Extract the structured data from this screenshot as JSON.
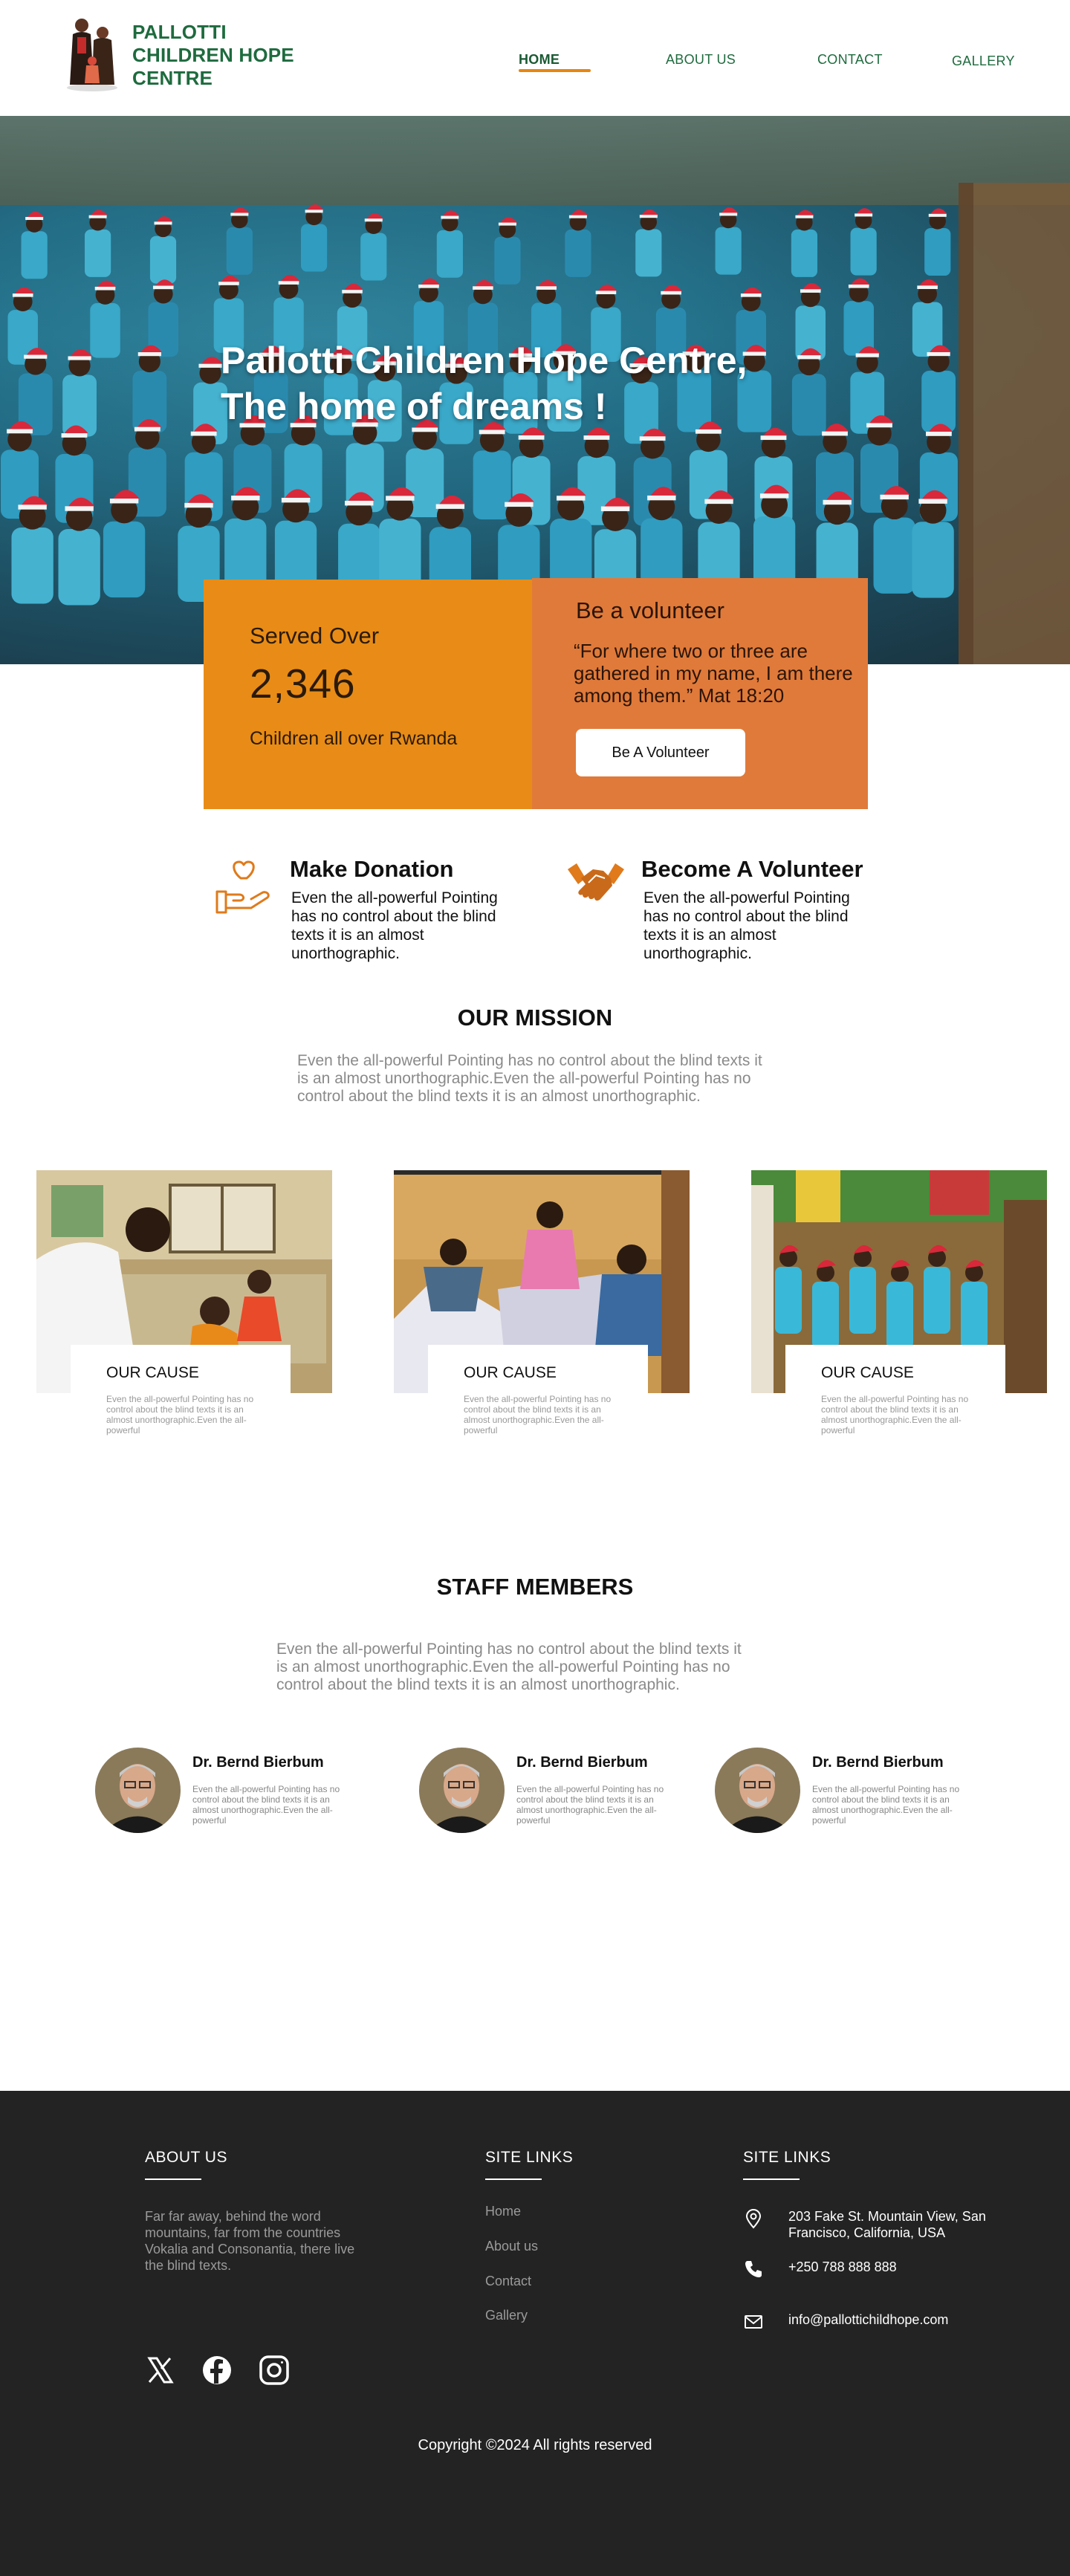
{
  "header": {
    "brand_line1": "PALLOTTI",
    "brand_line2": "CHILDREN HOPE",
    "brand_line3": "CENTRE",
    "nav": {
      "home": "HOME",
      "about": "ABOUT US",
      "contact": "CONTACT",
      "gallery": "GALLERY"
    },
    "active_nav": "HOME",
    "brand_color": "#1e6b3e",
    "accent_color": "#e8850f"
  },
  "hero": {
    "title_line1": "Pallotti Children Hope Centre,",
    "title_line2": "The home of dreams !"
  },
  "stats": {
    "served_label": "Served Over",
    "served_number": "2,346",
    "served_sub": "Children all over  Rwanda",
    "served_color": "#e88c17"
  },
  "volunteer_box": {
    "title": "Be a volunteer",
    "quote": "“For where two or three are gathered in my name, I am there among them.”  Mat 18:20",
    "button": "Be A Volunteer",
    "box_color": "#e07a3a"
  },
  "features": {
    "donate": {
      "icon": "heart-hand-icon",
      "title": "Make Donation",
      "text": "Even the all-powerful Pointing has no control about the blind texts it is an almost unorthographic."
    },
    "volunteer": {
      "icon": "handshake-icon",
      "title": "Become A Volunteer",
      "text": "Even the all-powerful Pointing has no control about the blind texts it is an almost unorthographic."
    }
  },
  "mission": {
    "title": "OUR MISSION",
    "text": "Even the all-powerful Pointing has no control about the blind texts it is an almost unorthographic.Even the all-powerful Pointing has no control about the blind texts it is an almost unorthographic."
  },
  "causes": [
    {
      "title": "OUR CAUSE",
      "text": "Even the all-powerful Pointing has no control about the blind texts it is an almost unorthographic.Even the all-powerful"
    },
    {
      "title": "OUR CAUSE",
      "text": "Even the all-powerful Pointing has no control about the blind texts it is an almost unorthographic.Even the all-powerful"
    },
    {
      "title": "OUR CAUSE",
      "text": "Even the all-powerful Pointing has no control about the blind texts it is an almost unorthographic.Even the all-powerful"
    }
  ],
  "staff": {
    "title": "STAFF MEMBERS",
    "text": "Even the all-powerful Pointing has no control about the blind texts it is an almost unorthographic.Even the all-powerful Pointing has no control about the blind texts it is an almost unorthographic.",
    "members": [
      {
        "name": "Dr.  Bernd Bierbum",
        "text": "Even the all-powerful Pointing has no control about the blind texts it is an almost unorthographic.Even the all-powerful"
      },
      {
        "name": "Dr.  Bernd Bierbum",
        "text": "Even the all-powerful Pointing has no control about the blind texts it is an almost unorthographic.Even the all-powerful"
      },
      {
        "name": "Dr.  Bernd Bierbum",
        "text": "Even the all-powerful Pointing has no control about the blind texts it is an almost unorthographic.Even the all-powerful"
      }
    ]
  },
  "footer": {
    "about_title": "ABOUT US",
    "about_text": "Far far away, behind the word mountains, far from the countries Vokalia and Consonantia, there live the blind texts.",
    "links_title": "SITE LINKS",
    "links": [
      "Home",
      "About us",
      "Contact",
      "Gallery"
    ],
    "contact_title": "SITE LINKS",
    "address": "203 Fake St. Mountain View, San Francisco, California, USA",
    "phone": "+250 788 888 888",
    "email": "info@pallottichildhope.com",
    "social": [
      "x-icon",
      "facebook-icon",
      "instagram-icon"
    ],
    "copyright": "Copyright ©2024 All rights reserved",
    "bg_color": "#232323"
  }
}
